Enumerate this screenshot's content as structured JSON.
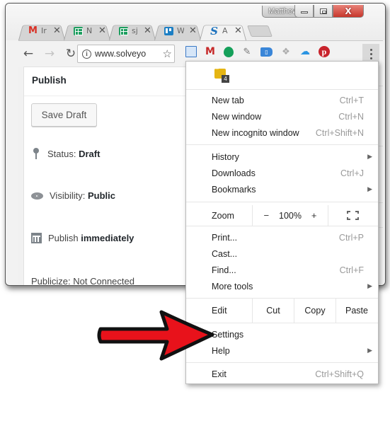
{
  "window": {
    "profile_name": "Matthew",
    "controls": {
      "minimize": "minimize",
      "maximize": "maximize",
      "close": "X"
    }
  },
  "tabs": [
    {
      "icon": "gmail-icon",
      "title": "Ir",
      "close": "✕"
    },
    {
      "icon": "sheets-icon",
      "title": "N",
      "close": "✕"
    },
    {
      "icon": "sheets-icon",
      "title": "sj",
      "close": "✕"
    },
    {
      "icon": "trello-icon",
      "title": "W",
      "close": "✕"
    },
    {
      "icon": "solveyourtech-icon",
      "title": "A",
      "close": "✕",
      "active": true
    }
  ],
  "toolbar": {
    "back": "←",
    "forward": "→",
    "reload": "↻",
    "info": "i",
    "url": "www.solveyo",
    "star": "☆",
    "extensions": [
      "screencast-icon",
      "gmail-checker-icon",
      "evernote-icon",
      "note-icon",
      "tag-icon",
      "dropbox-icon",
      "onedrive-icon",
      "pinterest-icon"
    ],
    "menu_label": "Customize and control Google Chrome"
  },
  "publish_panel": {
    "title": "Publish",
    "save_draft": "Save Draft",
    "status_label": "Status:",
    "status_value": "Draft",
    "visibility_label": "Visibility:",
    "visibility_value": "Public",
    "publish_label": "Publish",
    "publish_value": "immediately",
    "publicize": "Publicize: Not Connected"
  },
  "menu": {
    "extension_badge": "4",
    "items": [
      {
        "label": "New tab",
        "shortcut": "Ctrl+T"
      },
      {
        "label": "New window",
        "shortcut": "Ctrl+N"
      },
      {
        "label": "New incognito window",
        "shortcut": "Ctrl+Shift+N"
      },
      {
        "label": "History",
        "submenu": "▶"
      },
      {
        "label": "Downloads",
        "shortcut": "Ctrl+J"
      },
      {
        "label": "Bookmarks",
        "submenu": "▶"
      },
      {
        "label": "Print...",
        "shortcut": "Ctrl+P"
      },
      {
        "label": "Cast..."
      },
      {
        "label": "Find...",
        "shortcut": "Ctrl+F"
      },
      {
        "label": "More tools",
        "submenu": "▶"
      },
      {
        "label": "Settings"
      },
      {
        "label": "Help",
        "submenu": "▶"
      },
      {
        "label": "Exit",
        "shortcut": "Ctrl+Shift+Q"
      }
    ],
    "zoom": {
      "label": "Zoom",
      "minus": "−",
      "value": "100%",
      "plus": "+"
    },
    "edit": {
      "label": "Edit",
      "cut": "Cut",
      "copy": "Copy",
      "paste": "Paste"
    }
  },
  "annotation": {
    "color": "#e8121b",
    "points_to": "Settings"
  }
}
